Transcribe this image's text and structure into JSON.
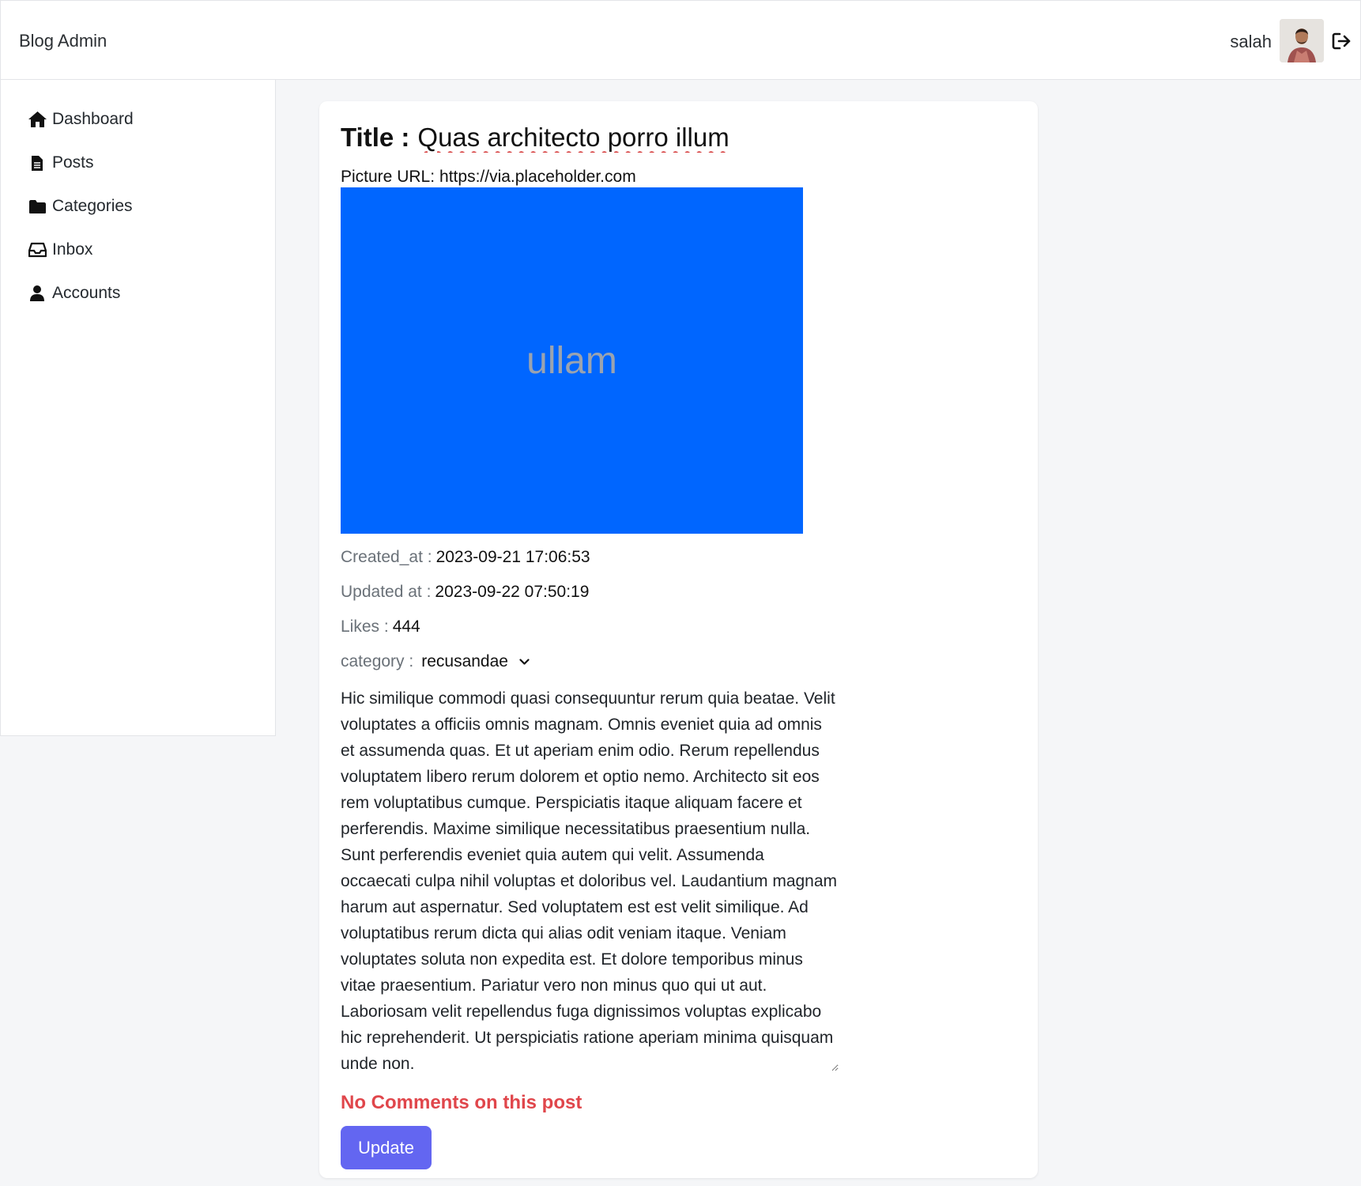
{
  "header": {
    "brand": "Blog Admin",
    "user_name": "salah",
    "avatar_alt": "user avatar",
    "logout_icon": "sign-out-icon"
  },
  "sidebar": {
    "items": [
      {
        "label": "Dashboard",
        "icon": "home-icon"
      },
      {
        "label": "Posts",
        "icon": "file-icon"
      },
      {
        "label": "Categories",
        "icon": "folder-icon"
      },
      {
        "label": "Inbox",
        "icon": "inbox-icon"
      },
      {
        "label": "Accounts",
        "icon": "user-icon"
      }
    ]
  },
  "post": {
    "title_label": "Title :",
    "title_value": "Quas architecto porro illum",
    "picture_label": "Picture URL:",
    "picture_value": "https://via.placeholder.com",
    "image_text": "ullam",
    "created_label": "Created_at :",
    "created_value": "2023-09-21 17:06:53",
    "updated_label": "Updated at :",
    "updated_value": "2023-09-22 07:50:19",
    "likes_label": "Likes :",
    "likes_value": "444",
    "category_label": "category :",
    "category_value": "recusandae",
    "content": "Hic similique commodi quasi consequuntur rerum quia beatae. Velit voluptates a officiis omnis magnam. Omnis eveniet quia ad omnis et assumenda quas. Et ut aperiam enim odio. Rerum repellendus voluptatem libero rerum dolorem et optio nemo. Architecto sit eos rem voluptatibus cumque. Perspiciatis itaque aliquam facere et perferendis. Maxime similique necessitatibus praesentium nulla. Sunt perferendis eveniet quia autem qui velit. Assumenda occaecati culpa nihil voluptas et doloribus vel. Laudantium magnam harum aut aspernatur. Sed voluptatem est est velit similique. Ad voluptatibus rerum dicta qui alias odit veniam itaque. Veniam voluptates soluta non expedita est. Et dolore temporibus minus vitae praesentium. Pariatur vero non minus quo qui ut aut. Laboriosam velit repellendus fuga dignissimos voluptas explicabo hic reprehenderit. Ut perspiciatis ratione aperiam minima quisquam unde non.",
    "no_comments": "No Comments on this post",
    "update_label": "Update"
  },
  "colors": {
    "accent": "#6366f1",
    "image_bg": "#0066ff",
    "error": "#e0464b"
  }
}
